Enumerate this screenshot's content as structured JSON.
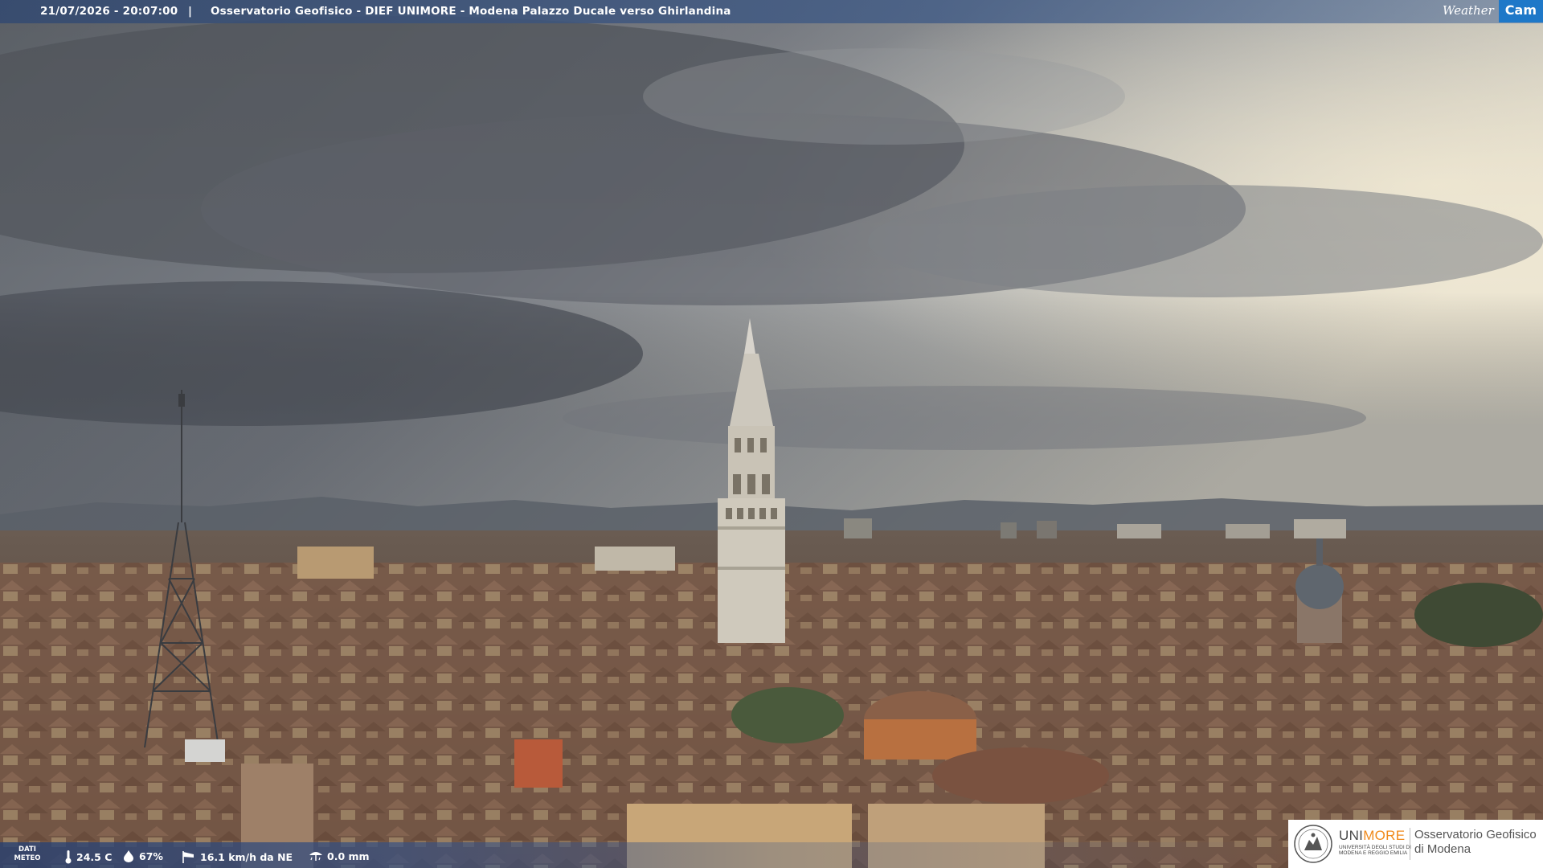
{
  "header": {
    "timestamp": "21/07/2026 - 20:07:00",
    "separator": "|",
    "title": "Osservatorio Geofisico - DIEF UNIMORE - Modena Palazzo Ducale verso Ghirlandina"
  },
  "brand": {
    "weather": "Weather",
    "cam": "Cam"
  },
  "weather_bar": {
    "label_line1": "DATI",
    "label_line2": "METEO",
    "temperature": "24.5 C",
    "humidity": "67%",
    "wind": "16.1 km/h da NE",
    "rain": "0.0 mm"
  },
  "logo": {
    "uni_part1": "UNI",
    "uni_part2": "MORE",
    "subtitle": "UNIVERSITÀ DEGLI STUDI DI MODENA E REGGIO EMILIA",
    "observatory_line1": "Osservatorio Geofisico",
    "observatory_line2": "di Modena"
  },
  "icons": {
    "temperature": "thermometer-icon",
    "humidity": "droplet-icon",
    "wind": "wind-sock-icon",
    "rain": "rain-gauge-icon",
    "seal": "university-seal-icon"
  },
  "colors": {
    "cam_badge": "#1e78c8",
    "unimore_orange": "#f08a1c"
  }
}
